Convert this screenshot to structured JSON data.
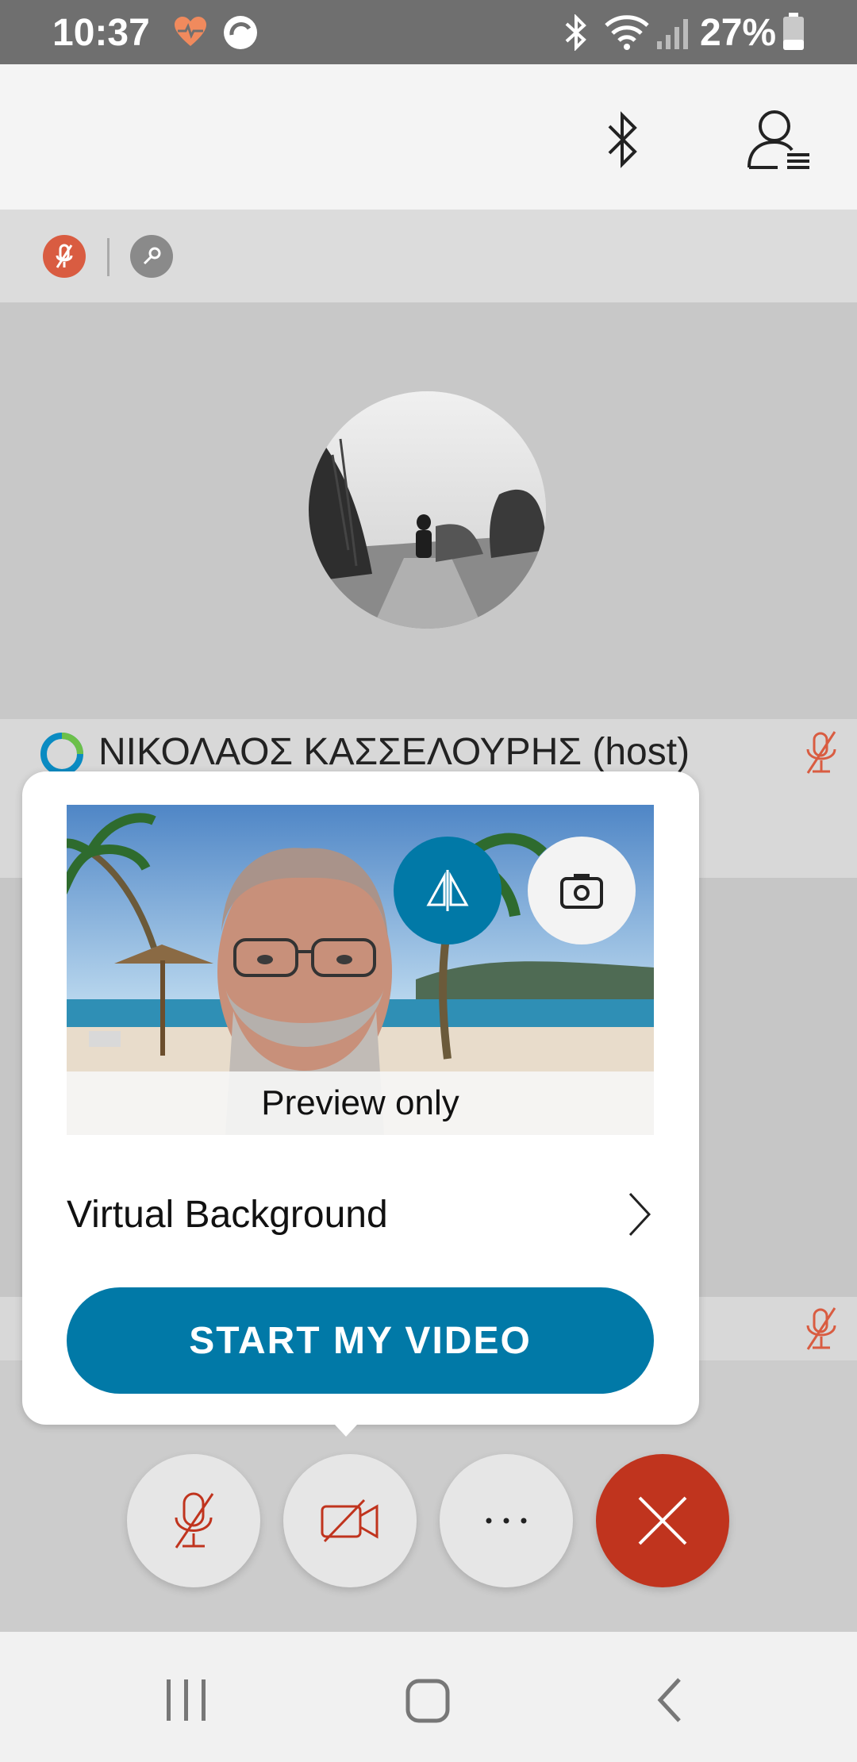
{
  "status_bar": {
    "time": "10:37",
    "battery_percent": "27%"
  },
  "participants": [
    {
      "name": "ΝΙΚΟΛΑΟΣ ΚΑΣΣΕΛΟΥΡΗΣ (host)",
      "muted": true
    }
  ],
  "popup": {
    "preview_label": "Preview only",
    "virtual_background_label": "Virtual Background",
    "start_video_label": "START MY VIDEO"
  },
  "colors": {
    "accent": "#0179a7",
    "danger": "#c0341e",
    "muted_icon": "#d95c41"
  }
}
